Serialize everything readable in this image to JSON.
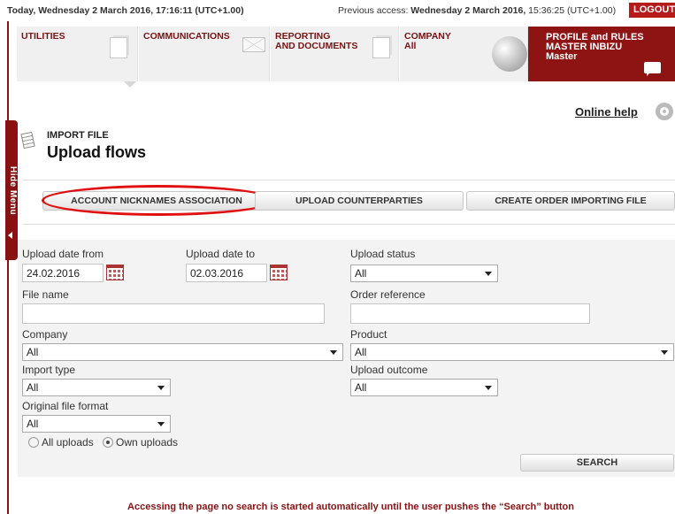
{
  "topbar": {
    "today": "Today, Wednesday 2 March 2016, 17:16:11 (UTC+1.00)",
    "previous_label": "Previous access: ",
    "previous_date": "Wednesday 2 March 2016,",
    "previous_time": " 15:36:25 (UTC+1.00)",
    "logout_label": "LOGOUT"
  },
  "sidebar": {
    "hide_menu_label": "Hide Menu"
  },
  "nav": {
    "utilities": "UTILITIES",
    "communications": "COMMUNICATIONS",
    "reporting_line1": "REPORTING",
    "reporting_line2": "AND DOCUMENTS",
    "company_line1": "COMPANY",
    "company_line2": "All",
    "profile_line1": "PROFILE and RULES",
    "profile_line2": "MASTER INBIZU",
    "profile_line3": "Master"
  },
  "help": {
    "label": "Online help"
  },
  "page": {
    "section": "IMPORT FILE",
    "title": "Upload flows"
  },
  "actions": {
    "account_nicknames": "ACCOUNT NICKNAMES ASSOCIATION",
    "upload_counterparties": "UPLOAD COUNTERPARTIES",
    "create_order": "CREATE ORDER IMPORTING FILE"
  },
  "form": {
    "upload_date_from_label": "Upload date from",
    "upload_date_from_value": "24.02.2016",
    "upload_date_to_label": "Upload date to",
    "upload_date_to_value": "02.03.2016",
    "upload_status_label": "Upload status",
    "upload_status_value": "All",
    "file_name_label": "File name",
    "file_name_value": "",
    "order_reference_label": "Order reference",
    "order_reference_value": "",
    "company_label": "Company",
    "company_value": "All",
    "product_label": "Product",
    "product_value": "All",
    "import_type_label": "Import type",
    "import_type_value": "All",
    "upload_outcome_label": "Upload outcome",
    "upload_outcome_value": "All",
    "original_format_label": "Original file format",
    "original_format_value": "All",
    "radio_all_label": "All uploads",
    "radio_own_label": "Own uploads",
    "radio_selected": "own",
    "search_label": "SEARCH"
  },
  "footer": {
    "note": "Accessing the page no search is started automatically until the user pushes the “Search” button"
  },
  "colors": {
    "brand_red": "#8e1313",
    "logout_red": "#b51b1b",
    "highlight_oval": "#e01010"
  }
}
